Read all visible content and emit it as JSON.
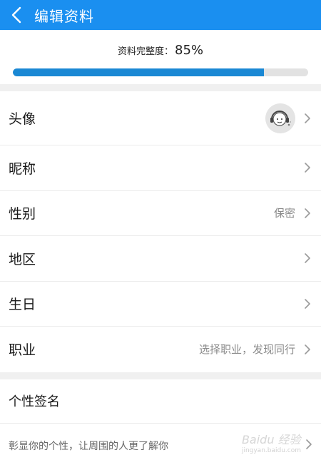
{
  "header": {
    "title": "编辑资料"
  },
  "progress": {
    "label": "资料完整度：",
    "percent_text": "85%",
    "value": 0.85
  },
  "rows": [
    {
      "label": "头像",
      "value": ""
    },
    {
      "label": "昵称",
      "value": ""
    },
    {
      "label": "性别",
      "value": "保密"
    },
    {
      "label": "地区",
      "value": ""
    },
    {
      "label": "生日",
      "value": ""
    },
    {
      "label": "职业",
      "value": "选择职业，发现同行"
    }
  ],
  "signature": {
    "title": "个性签名",
    "placeholder": "彰显你的个性，让周围的人更了解你"
  },
  "watermark": {
    "logo": "Baidu 经验",
    "url": "jingyan.baidu.com"
  },
  "colors": {
    "header_bg": "#1a8ff0",
    "progress_fill": "#1a88d4",
    "progress_track": "#e2e2e2"
  },
  "icons": {
    "back": "chevron-left-icon",
    "chevron": "chevron-right-icon",
    "avatar": "headphones-avatar-icon"
  }
}
